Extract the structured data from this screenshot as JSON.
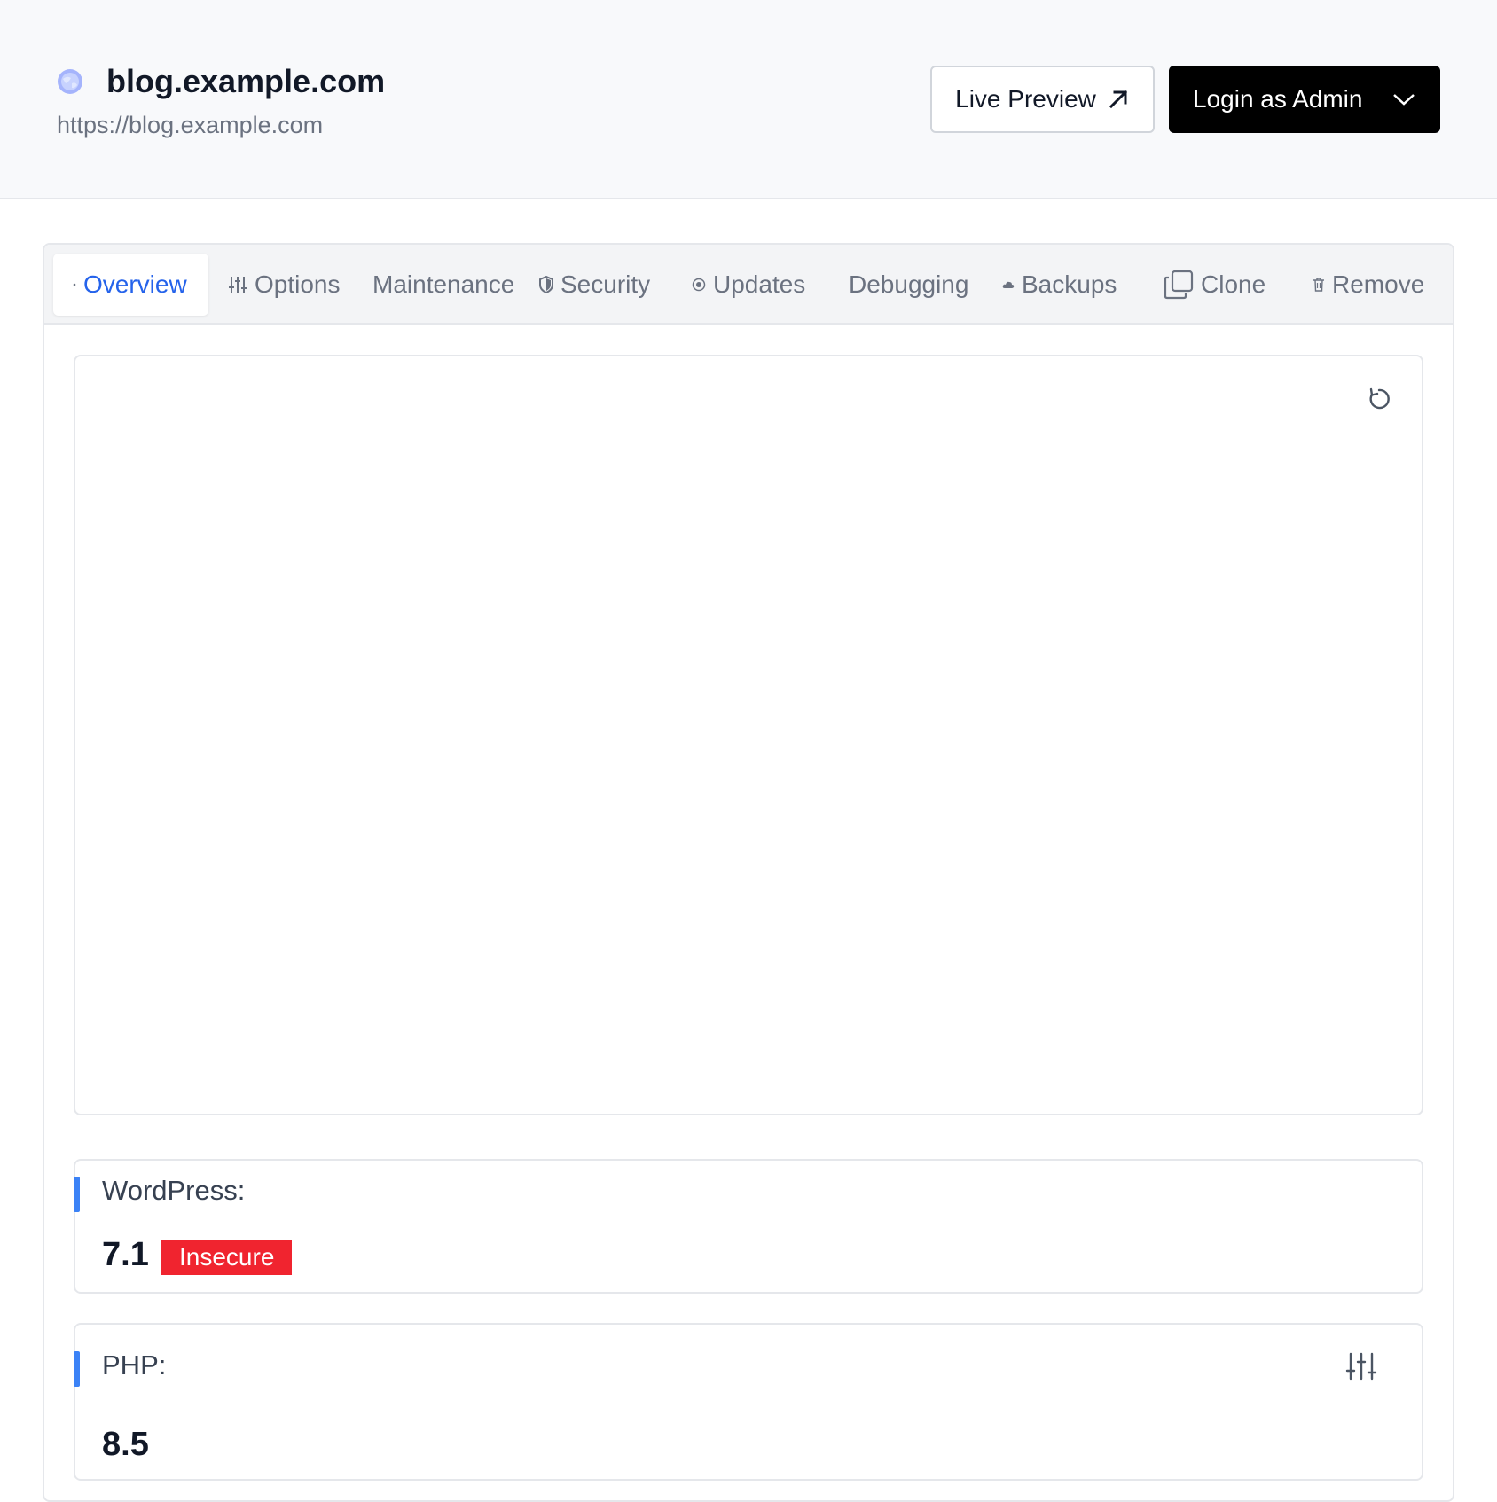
{
  "site": {
    "title": "blog.example.com",
    "url": "https://blog.example.com",
    "icon": "globe-icon"
  },
  "actions": {
    "live_preview_label": "Live Preview",
    "live_preview_icon": "external-arrow-icon",
    "login_label": "Login as Admin",
    "login_dropdown_icon": "chevron-down-icon"
  },
  "tabs": [
    {
      "label": "Overview",
      "icon": "dot-icon",
      "active": true
    },
    {
      "label": "Options",
      "icon": "sliders-icon"
    },
    {
      "label": "Maintenance",
      "icon": ""
    },
    {
      "label": "Security",
      "icon": "shield-icon"
    },
    {
      "label": "Updates",
      "icon": "update-icon"
    },
    {
      "label": "Debugging",
      "icon": ""
    },
    {
      "label": "Backups",
      "icon": "cloud-icon"
    },
    {
      "label": "Clone",
      "icon": "copy-icon"
    },
    {
      "label": "Remove",
      "icon": "trash-icon"
    }
  ],
  "preview": {
    "refresh_icon": "refresh-icon"
  },
  "wordpress": {
    "label": "WordPress:",
    "version": "7.1",
    "status": "Insecure"
  },
  "php": {
    "label": "PHP:",
    "version": "8.5",
    "settings_icon": "sliders-icon"
  },
  "colors": {
    "accent": "#3b82f6",
    "active_tab": "#2563eb",
    "insecure": "#f0242f",
    "login_button": "#000000"
  }
}
